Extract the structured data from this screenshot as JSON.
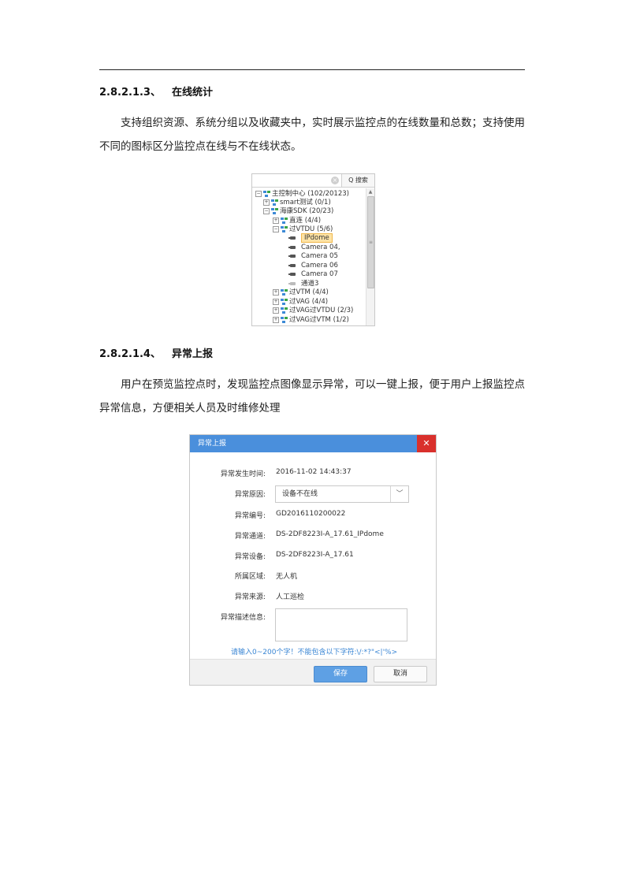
{
  "section1": {
    "number": "2.8.2.1.3、",
    "title": "在线统计",
    "paragraph": "支持组织资源、系统分组以及收藏夹中，实时展示监控点的在线数量和总数；支持使用不同的图标区分监控点在线与不在线状态。"
  },
  "tree": {
    "search_clear_icon": "clear-icon",
    "search_button": "Q 搜索",
    "scroll_grip": "≡",
    "nodes": [
      {
        "type": "group",
        "expander": "⊟",
        "label": "主控制中心 (102/20123)"
      },
      {
        "type": "group",
        "expander": "⊞",
        "label": "smart测试 (0/1)"
      },
      {
        "type": "group",
        "expander": "⊟",
        "label": "海康SDK (20/23)"
      },
      {
        "type": "group",
        "expander": "⊞",
        "label": "直连 (4/4)"
      },
      {
        "type": "group",
        "expander": "⊟",
        "label": "过VTDU (5/6)"
      },
      {
        "type": "camera",
        "label": "IPdome",
        "selected": true,
        "online": true
      },
      {
        "type": "camera",
        "label": "Camera 04,",
        "online": true
      },
      {
        "type": "camera",
        "label": "Camera 05",
        "online": true
      },
      {
        "type": "camera",
        "label": "Camera 06",
        "online": true
      },
      {
        "type": "camera",
        "label": "Camera 07",
        "online": true
      },
      {
        "type": "camera",
        "label": "通道3",
        "online": false
      },
      {
        "type": "group",
        "expander": "⊞",
        "label": "过VTM (4/4)"
      },
      {
        "type": "group",
        "expander": "⊞",
        "label": "过VAG (4/4)"
      },
      {
        "type": "group",
        "expander": "⊞",
        "label": "过VAG过VTDU (2/3)"
      },
      {
        "type": "group",
        "expander": "⊞",
        "label": "过VAG过VTM (1/2)"
      }
    ]
  },
  "section2": {
    "number": "2.8.2.1.4、",
    "title": "异常上报",
    "paragraph": "用户在预览监控点时，发现监控点图像显示异常，可以一键上报，便于用户上报监控点异常信息，方便相关人员及时维修处理"
  },
  "dialog": {
    "title": "异常上报",
    "close_label": "✕",
    "fields": {
      "time_label": "异常发生时间:",
      "time_value": "2016-11-02 14:43:37",
      "reason_label": "异常原因:",
      "reason_value": "设备不在线",
      "reason_arrow": "﹀",
      "code_label": "异常编号:",
      "code_value": "GD2016110200022",
      "channel_label": "异常通道:",
      "channel_value": "DS-2DF8223I-A_17.61_IPdome",
      "device_label": "异常设备:",
      "device_value": "DS-2DF8223I-A_17.61",
      "area_label": "所属区域:",
      "area_value": "无人机",
      "source_label": "异常来源:",
      "source_value": "人工巡检",
      "desc_label": "异常描述信息:",
      "desc_value": ""
    },
    "hint": "请输入0~200个字！不能包含以下字符:\\/:*?\"<|'%>",
    "save_label": "保存",
    "cancel_label": "取消"
  },
  "colors": {
    "dialog_title_bar": "#4a8fdc",
    "close_button": "#d9302c",
    "save_button": "#5ea0e4",
    "hint_text": "#3a86d4",
    "selected_node": "#fde3a6"
  }
}
